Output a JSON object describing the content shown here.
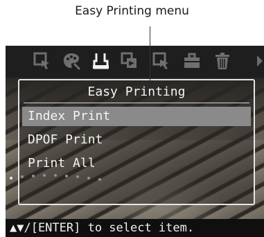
{
  "callout": {
    "label": "Easy Printing menu"
  },
  "toolbar": {
    "icons": [
      "cursor-frame-icon",
      "palette-icon",
      "print-icon",
      "copy-icon",
      "magnify-cursor-icon",
      "toolbox-icon",
      "trash-icon"
    ],
    "active_icon": "print-icon",
    "active_color": "#f2f2f2",
    "inactive_color": "#6f6f6f"
  },
  "menu": {
    "title": "Easy Printing",
    "items": [
      {
        "label": "Index Print",
        "selected": true
      },
      {
        "label": "DPOF Print",
        "selected": false
      },
      {
        "label": "Print All",
        "selected": false
      }
    ]
  },
  "hint": {
    "text": "▲▼/[ENTER] to select item."
  }
}
